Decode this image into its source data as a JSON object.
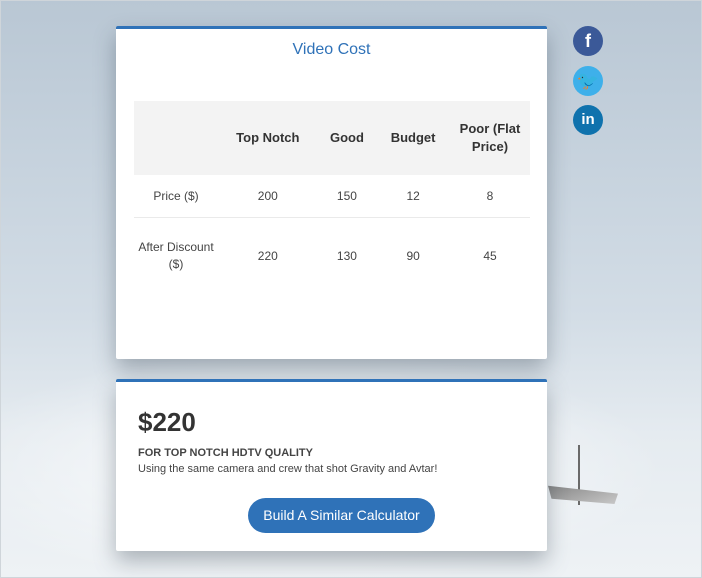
{
  "table_card": {
    "title": "Video Cost",
    "headers": [
      "",
      "Top Notch",
      "Good",
      "Budget",
      "Poor (Flat Price)"
    ],
    "rows": [
      {
        "label": "Price ($)",
        "values": [
          "200",
          "150",
          "12",
          "8"
        ]
      },
      {
        "label": "After Discount ($)",
        "values": [
          "220",
          "130",
          "90",
          "45"
        ]
      }
    ]
  },
  "result_card": {
    "total": "$220",
    "subtitle": "FOR TOP NOTCH HDTV QUALITY",
    "description": "Using the same camera and crew that shot Gravity and Avtar!",
    "cta_label": "Build A Similar Calculator"
  },
  "social": {
    "facebook": "f",
    "twitter": "🐦",
    "linkedin": "in"
  },
  "colors": {
    "accent": "#2f72b8",
    "facebook": "#3b5998",
    "twitter": "#3eb0ea",
    "linkedin": "#0f72ad"
  }
}
